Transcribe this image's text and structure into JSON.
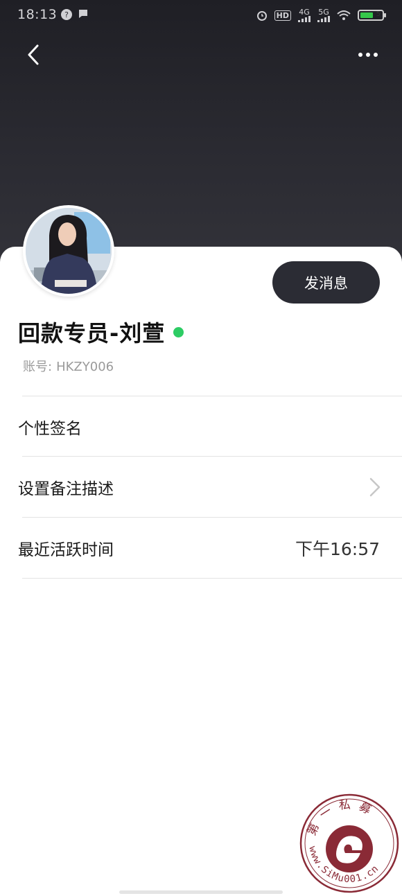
{
  "status_bar": {
    "time": "18:13",
    "network": [
      "HD",
      "4G",
      "5G"
    ],
    "battery_level": "5"
  },
  "header": {
    "back_icon": "chevron-left-icon",
    "more_icon": "more-dots-icon"
  },
  "profile": {
    "name": "回款专员-刘萱",
    "online": true,
    "online_color": "#2dcc64",
    "account_label": "账号:",
    "account_id": "HKZY006",
    "message_button": "发消息"
  },
  "rows": [
    {
      "label": "个性签名",
      "value": "",
      "chevron": false
    },
    {
      "label": "设置备注描述",
      "value": "",
      "chevron": true
    },
    {
      "label": "最近活跃时间",
      "value": "下午16:57",
      "chevron": false
    }
  ],
  "watermark": {
    "title": "第一私募",
    "url": "www.SiMu001.cn"
  },
  "colors": {
    "header_bg": "#2a2a31",
    "button_bg": "#2b2c34",
    "watermark": "#8a2a36"
  }
}
